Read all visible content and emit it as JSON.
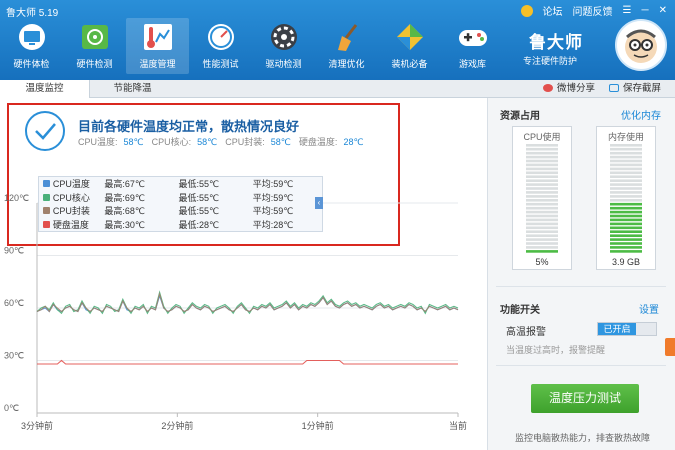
{
  "app": {
    "title": "鲁大师 5.19"
  },
  "top_links": {
    "forum": "论坛",
    "feedback": "问题反馈"
  },
  "nav": [
    {
      "label": "硬件体检",
      "icon": "monitor-icon"
    },
    {
      "label": "硬件检测",
      "icon": "chip-icon"
    },
    {
      "label": "温度管理",
      "icon": "thermometer-icon",
      "active": true
    },
    {
      "label": "性能测试",
      "icon": "gauge-icon"
    },
    {
      "label": "驱动检测",
      "icon": "driver-icon"
    },
    {
      "label": "清理优化",
      "icon": "broom-icon"
    },
    {
      "label": "装机必备",
      "icon": "package-icon"
    },
    {
      "label": "游戏库",
      "icon": "gamepad-icon"
    }
  ],
  "brand": {
    "name": "鲁大师",
    "slogan": "专注硬件防护"
  },
  "tabs": [
    {
      "label": "温度监控",
      "active": true
    },
    {
      "label": "节能降温"
    }
  ],
  "tab_actions": {
    "share": "微博分享",
    "save": "保存截屏"
  },
  "status": {
    "title": "目前各硬件温度均正常，散热情况良好",
    "items": [
      {
        "label": "CPU温度:",
        "value": "58℃"
      },
      {
        "label": "CPU核心:",
        "value": "58℃"
      },
      {
        "label": "CPU封装:",
        "value": "58℃"
      },
      {
        "label": "硬盘温度:",
        "value": "28℃"
      }
    ]
  },
  "legend": [
    {
      "name": "CPU温度",
      "max": "最高:67℃",
      "min": "最低:55℃",
      "avg": "平均:59℃",
      "color": "#4b8fd6"
    },
    {
      "name": "CPU核心",
      "max": "最高:69℃",
      "min": "最低:55℃",
      "avg": "平均:59℃",
      "color": "#4ab07a"
    },
    {
      "name": "CPU封装",
      "max": "最高:68℃",
      "min": "最低:55℃",
      "avg": "平均:59℃",
      "color": "#a0816c"
    },
    {
      "name": "硬盘温度",
      "max": "最高:30℃",
      "min": "最低:28℃",
      "avg": "平均:28℃",
      "color": "#e2504d"
    }
  ],
  "chart_data": {
    "type": "line",
    "ylim": [
      0,
      120
    ],
    "y_ticks": [
      "120℃",
      "90℃",
      "60℃",
      "30℃",
      "0℃"
    ],
    "x_ticks": [
      "3分钟前",
      "2分钟前",
      "1分钟前",
      "当前"
    ],
    "grid": true,
    "series": [
      {
        "name": "CPU温度",
        "color": "#4b8fd6",
        "values": [
          58,
          59,
          60,
          58,
          62,
          59,
          58,
          60,
          61,
          59,
          58,
          63,
          59,
          58,
          60,
          59,
          58,
          61,
          60,
          59,
          58,
          64,
          59,
          58,
          60,
          59,
          61,
          58,
          60,
          59,
          67,
          60,
          58,
          59,
          61,
          60,
          58,
          59,
          62,
          60,
          59,
          61,
          60,
          58,
          59,
          60,
          61,
          59,
          58,
          60,
          62,
          59,
          58,
          60,
          59,
          61,
          60,
          62,
          59,
          60,
          61,
          63,
          60,
          62,
          59,
          61,
          60,
          62,
          61,
          63,
          66,
          62,
          64,
          61,
          60,
          62,
          63,
          61,
          62,
          60,
          61,
          60,
          59,
          61,
          62,
          60,
          61,
          59,
          60,
          61,
          60,
          62,
          61,
          59,
          60,
          58,
          61,
          60,
          59,
          60,
          61,
          59,
          60,
          59
        ]
      },
      {
        "name": "CPU核心",
        "color": "#4ab07a",
        "values": [
          58,
          60,
          61,
          59,
          63,
          59,
          57,
          61,
          62,
          58,
          59,
          64,
          60,
          57,
          61,
          60,
          57,
          62,
          61,
          58,
          59,
          65,
          60,
          57,
          61,
          60,
          62,
          57,
          61,
          60,
          69,
          61,
          57,
          60,
          62,
          61,
          57,
          60,
          63,
          61,
          60,
          62,
          61,
          57,
          60,
          61,
          62,
          60,
          57,
          61,
          63,
          60,
          57,
          61,
          60,
          62,
          61,
          63,
          60,
          61,
          62,
          64,
          61,
          63,
          60,
          62,
          61,
          63,
          62,
          64,
          67,
          63,
          65,
          62,
          61,
          63,
          64,
          62,
          63,
          61,
          62,
          61,
          60,
          62,
          63,
          61,
          62,
          60,
          61,
          62,
          61,
          63,
          62,
          60,
          61,
          57,
          62,
          61,
          60,
          61,
          62,
          60,
          61,
          60
        ]
      },
      {
        "name": "CPU封装",
        "color": "#a0816c",
        "values": [
          58,
          59,
          61,
          58,
          62,
          60,
          58,
          60,
          61,
          59,
          58,
          63,
          60,
          58,
          60,
          59,
          58,
          61,
          60,
          59,
          58,
          64,
          60,
          58,
          60,
          59,
          61,
          58,
          60,
          59,
          68,
          60,
          58,
          59,
          61,
          60,
          58,
          59,
          62,
          60,
          59,
          61,
          60,
          58,
          59,
          60,
          61,
          59,
          58,
          60,
          62,
          59,
          58,
          60,
          59,
          61,
          60,
          62,
          59,
          60,
          61,
          63,
          60,
          62,
          59,
          61,
          60,
          62,
          61,
          63,
          66,
          62,
          64,
          61,
          60,
          62,
          63,
          61,
          62,
          60,
          61,
          60,
          59,
          61,
          62,
          60,
          61,
          59,
          60,
          61,
          60,
          62,
          61,
          59,
          60,
          58,
          61,
          60,
          59,
          60,
          61,
          59,
          60,
          59
        ]
      },
      {
        "name": "硬盘温度",
        "color": "#e2504d",
        "values": [
          28,
          28,
          28,
          28,
          28,
          28,
          30,
          28,
          28,
          28,
          28,
          28,
          28,
          28,
          28,
          28,
          28,
          28,
          28,
          28,
          28,
          28,
          28,
          28,
          28,
          28,
          28,
          28,
          28,
          28,
          28,
          28,
          28,
          28,
          28,
          28,
          28,
          28,
          28,
          28,
          28,
          28,
          28,
          28,
          28,
          28,
          28,
          28,
          28,
          28,
          28,
          28,
          28,
          28,
          28,
          28,
          28,
          28,
          28,
          28,
          28,
          28,
          28,
          28,
          28,
          28,
          30,
          30,
          30,
          30,
          30,
          30,
          30,
          30,
          30,
          28,
          28,
          28,
          28,
          28,
          28,
          28,
          28,
          28,
          28,
          28,
          28,
          28,
          28,
          28,
          28,
          28,
          28,
          28,
          28,
          28,
          28,
          28,
          28,
          28,
          28,
          28,
          28,
          28
        ]
      }
    ]
  },
  "side": {
    "resources_title": "资源占用",
    "optimize_link": "优化内存",
    "cpu": {
      "label": "CPU使用",
      "value": "5%",
      "fraction": 0.05
    },
    "mem": {
      "label": "内存使用",
      "value": "3.9 GB",
      "fraction": 0.48
    },
    "features_title": "功能开关",
    "settings_link": "设置",
    "alarm_label": "高温报警",
    "alarm_state": "已开启",
    "alarm_hint": "当温度过高时，报警提醒",
    "stress_button": "温度压力测试",
    "footer": "监控电脑散热能力，排查散热故障"
  }
}
